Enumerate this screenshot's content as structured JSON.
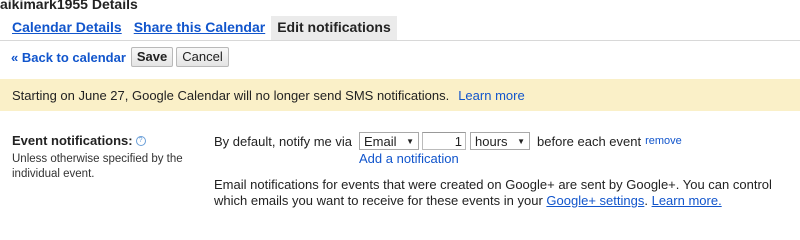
{
  "page": {
    "title": "aikimark1955 Details"
  },
  "tabs": [
    {
      "label": "Calendar Details",
      "active": false
    },
    {
      "label": "Share this Calendar",
      "active": false
    },
    {
      "label": "Edit notifications",
      "active": true
    }
  ],
  "toolbar": {
    "back_label": "« Back to calendar",
    "save_label": "Save",
    "cancel_label": "Cancel"
  },
  "banner": {
    "text": "Starting on June 27, Google Calendar will no longer send SMS notifications.",
    "link": "Learn more"
  },
  "event_notifications": {
    "label": "Event notifications:",
    "help_icon": "?",
    "description": "Unless otherwise specified by the individual event.",
    "prefix": "By default, notify me via",
    "method": "Email",
    "amount": "1",
    "unit": "hours",
    "suffix": "before each event",
    "remove_label": "remove",
    "add_label": "Add a notification"
  },
  "gplus_note": {
    "text": "Email notifications for events that were created on Google+ are sent by Google+. You can control which emails you want to receive for these events in your",
    "settings_link": "Google+ settings",
    "separator": ".",
    "learn_more": "Learn more.",
    "trailing_period": ""
  },
  "colors": {
    "link": "#1155cc",
    "banner_bg": "#faf0c8",
    "active_tab_bg": "#ebebeb"
  }
}
